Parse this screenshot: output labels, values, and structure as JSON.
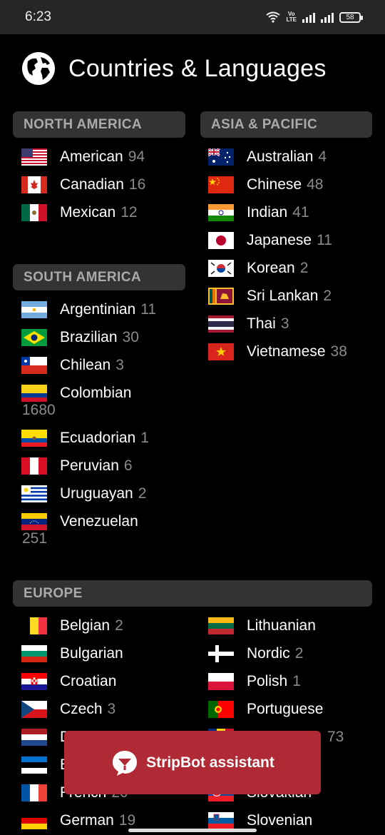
{
  "status": {
    "time": "6:23",
    "battery": "58",
    "volte": "Vo\nLTE"
  },
  "header": {
    "title": "Countries & Languages"
  },
  "sections": {
    "north_america": "NORTH AMERICA",
    "asia_pacific": "ASIA & PACIFIC",
    "south_america": "SOUTH AMERICA",
    "europe": "EUROPE"
  },
  "north_america": [
    {
      "name": "American",
      "count": "94"
    },
    {
      "name": "Canadian",
      "count": "16"
    },
    {
      "name": "Mexican",
      "count": "12"
    }
  ],
  "asia_pacific": [
    {
      "name": "Australian",
      "count": "4"
    },
    {
      "name": "Chinese",
      "count": "48"
    },
    {
      "name": "Indian",
      "count": "41"
    },
    {
      "name": "Japanese",
      "count": "11"
    },
    {
      "name": "Korean",
      "count": "2"
    },
    {
      "name": "Sri Lankan",
      "count": "2"
    },
    {
      "name": "Thai",
      "count": "3"
    },
    {
      "name": "Vietnamese",
      "count": "38"
    }
  ],
  "south_america": [
    {
      "name": "Argentinian",
      "count": "11"
    },
    {
      "name": "Brazilian",
      "count": "30"
    },
    {
      "name": "Chilean",
      "count": "3"
    },
    {
      "name": "Colombian",
      "count": "1680"
    },
    {
      "name": "Ecuadorian",
      "count": "1"
    },
    {
      "name": "Peruvian",
      "count": "6"
    },
    {
      "name": "Uruguayan",
      "count": "2"
    },
    {
      "name": "Venezuelan",
      "count": "251"
    }
  ],
  "europe_left": [
    {
      "name": "Belgian",
      "count": "2"
    },
    {
      "name": "Bulgarian",
      "count": ""
    },
    {
      "name": "Croatian",
      "count": ""
    },
    {
      "name": "Czech",
      "count": "3"
    },
    {
      "name": "D",
      "count": ""
    },
    {
      "name": "E",
      "count": ""
    },
    {
      "name": "French",
      "count": "20"
    },
    {
      "name": "German",
      "count": "19"
    }
  ],
  "europe_right": [
    {
      "name": "Lithuanian",
      "count": ""
    },
    {
      "name": "Nordic",
      "count": "2"
    },
    {
      "name": "Polish",
      "count": "1"
    },
    {
      "name": "Portuguese",
      "count": ""
    },
    {
      "name": "",
      "count": "73"
    },
    {
      "name": "",
      "count": ""
    },
    {
      "name": "Slovakian",
      "count": ""
    },
    {
      "name": "Slovenian",
      "count": ""
    }
  ],
  "assistant": {
    "label": "StripBot assistant"
  },
  "colors": {
    "background": "#000000",
    "section_bg": "#333333",
    "assistant_bg": "#b02a36",
    "count_gray": "#8a8a8a"
  },
  "icons": {
    "globe": "globe-icon",
    "assistant": "chat-bot-icon",
    "wifi": "wifi-icon",
    "signal": "signal-icon",
    "battery": "battery-icon"
  }
}
